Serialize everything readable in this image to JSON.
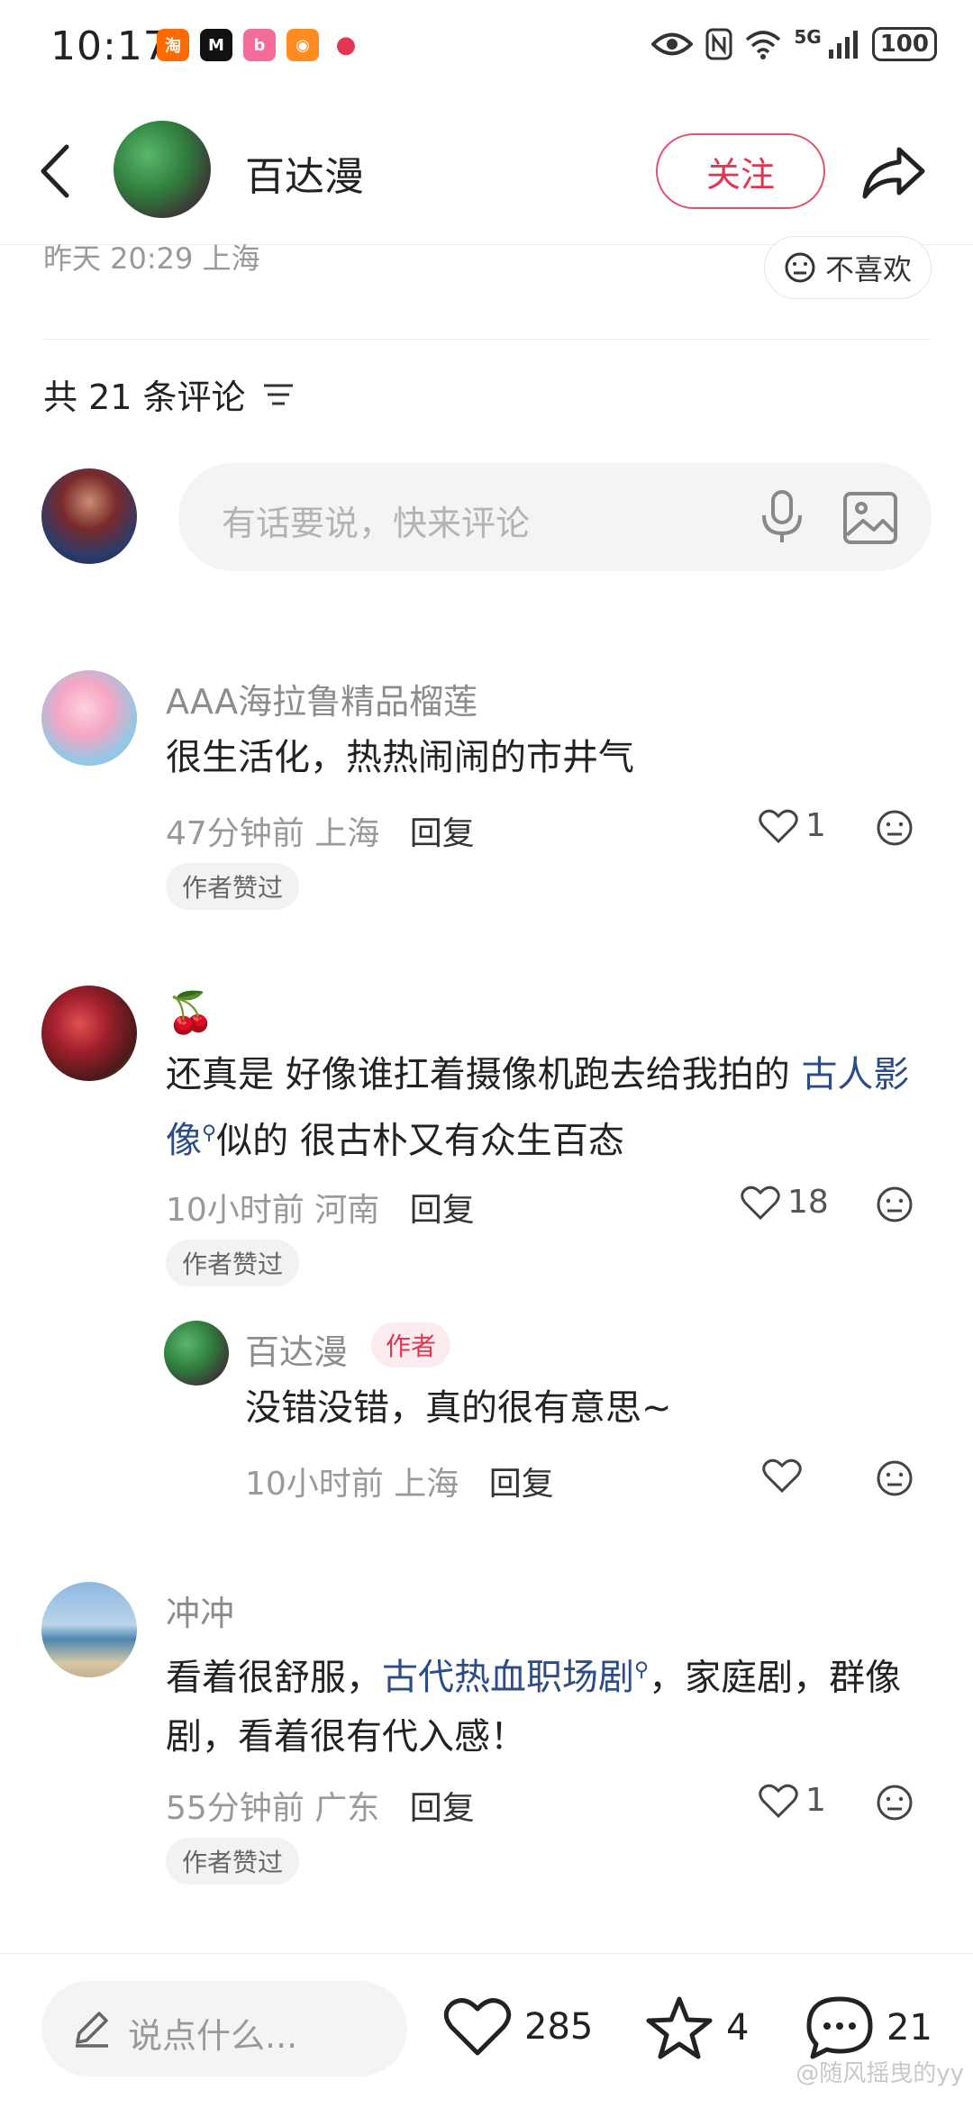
{
  "status_bar": {
    "time": "10:17",
    "network": "5G",
    "battery": "100",
    "app_icons": [
      "taobao-icon",
      "moji-icon",
      "bilibili-icon",
      "orange-app-icon",
      "red-app-icon"
    ]
  },
  "header": {
    "author_name": "百达漫",
    "follow_label": "关注"
  },
  "post": {
    "meta": "昨天 20:29 上海",
    "dislike_label": "不喜欢"
  },
  "comments_section": {
    "count_label": "共 21 条评论",
    "input_placeholder": "有话要说，快来评论"
  },
  "comments": [
    {
      "name": "AAA海拉鲁精品榴莲",
      "text": "很生活化，热热闹闹的市井气",
      "time_location": "47分钟前 上海",
      "reply_label": "回复",
      "likes": "1",
      "badge": "作者赞过"
    },
    {
      "name": "🍒",
      "text_before": "还真是 好像谁扛着摄像机跑去给我拍的 ",
      "link": "古人影像",
      "text_after": "似的 很古朴又有众生百态",
      "time_location": "10小时前 河南",
      "reply_label": "回复",
      "likes": "18",
      "badge": "作者赞过",
      "reply": {
        "name": "百达漫",
        "tag": "作者",
        "text": "没错没错，真的很有意思~",
        "time_location": "10小时前 上海",
        "reply_label": "回复"
      }
    },
    {
      "name": "冲冲",
      "text_before": "看着很舒服，",
      "link": "古代热血职场剧",
      "text_after": "，家庭剧，群像剧，看着很有代入感！",
      "time_location": "55分钟前 广东",
      "reply_label": "回复",
      "likes": "1",
      "badge": "作者赞过"
    }
  ],
  "bottom_bar": {
    "say_placeholder": "说点什么...",
    "likes": "285",
    "stars": "4",
    "comments": "21",
    "watermark": "@随风摇曳的yy"
  },
  "colors": {
    "accent": "#e3354f",
    "link": "#2b4c86",
    "muted": "#999999"
  }
}
